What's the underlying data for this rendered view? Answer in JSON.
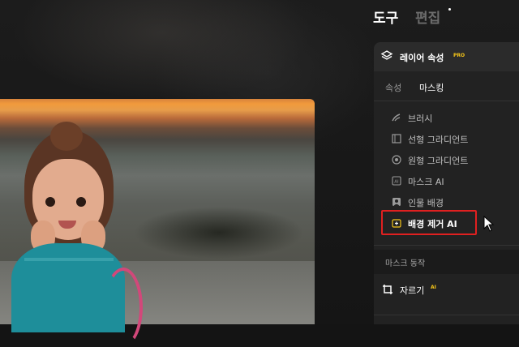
{
  "top_tabs": {
    "tools": "도구",
    "edit": "편집"
  },
  "panel": {
    "title": "레이어 속성",
    "badge": "PRO",
    "subtabs": [
      "속성",
      "마스킹"
    ],
    "tools": [
      {
        "label": "브러시",
        "icon": "brush-icon"
      },
      {
        "label": "선형 그라디언트",
        "icon": "linear-gradient-icon"
      },
      {
        "label": "원형 그라디언트",
        "icon": "radial-gradient-icon"
      },
      {
        "label": "마스크 AI",
        "icon": "ai-badge-icon"
      },
      {
        "label": "인물 배경",
        "icon": "portrait-icon"
      },
      {
        "label": "배경 제거 AI",
        "icon": "background-remove-icon"
      }
    ],
    "mask_action": "마스크 동작",
    "crop": {
      "label": "자르기",
      "badge": "AI"
    }
  },
  "colors": {
    "accent_yellow": "#f5c518",
    "highlight_red": "#e02020",
    "panel_bg": "#222222"
  }
}
